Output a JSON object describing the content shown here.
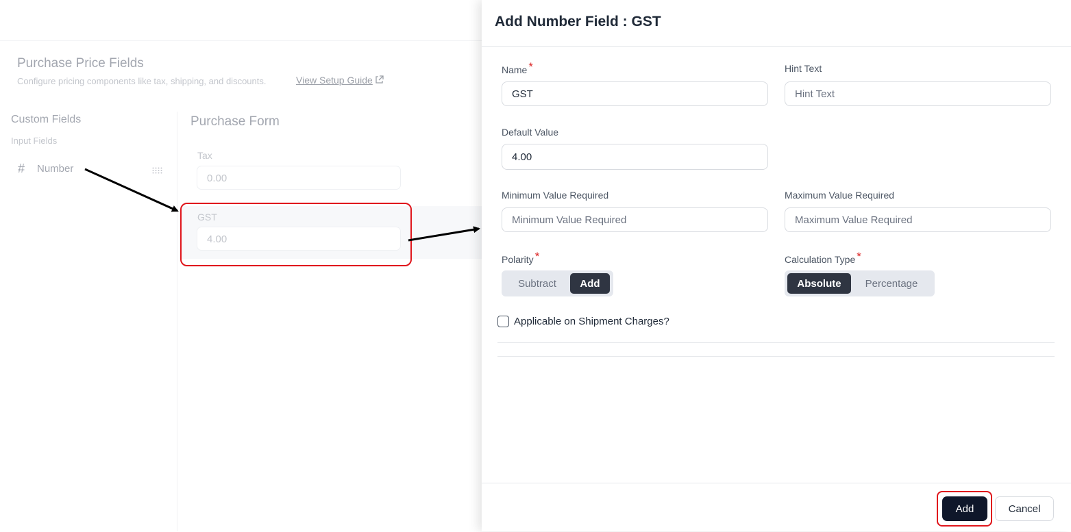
{
  "background": {
    "title": "Purchase Price Fields",
    "subtitle": "Configure pricing components like tax, shipping, and discounts.",
    "setup_guide_link": "View Setup Guide",
    "left_panel": {
      "title": "Custom Fields",
      "subtitle": "Input Fields",
      "item_icon": "#",
      "item_label": "Number"
    },
    "form": {
      "title": "Purchase Form",
      "fields": [
        {
          "label": "Tax",
          "value": "0.00"
        },
        {
          "label": "GST",
          "value": "4.00"
        }
      ]
    }
  },
  "drawer": {
    "title": "Add Number Field : GST",
    "name": {
      "label": "Name",
      "required_mark": "*",
      "value": "GST"
    },
    "hint": {
      "label": "Hint Text",
      "placeholder": "Hint Text"
    },
    "default_value": {
      "label": "Default Value",
      "value": "4.00"
    },
    "min_value": {
      "label": "Minimum Value Required",
      "placeholder": "Minimum Value Required"
    },
    "max_value": {
      "label": "Maximum Value Required",
      "placeholder": "Maximum Value Required"
    },
    "polarity": {
      "label": "Polarity",
      "required_mark": "*",
      "options": [
        "Subtract",
        "Add"
      ],
      "selected": "Add"
    },
    "calculation_type": {
      "label": "Calculation Type",
      "required_mark": "*",
      "options": [
        "Absolute",
        "Percentage"
      ],
      "selected": "Absolute"
    },
    "shipment_checkbox": {
      "label": "Applicable on Shipment Charges?",
      "checked": false
    },
    "footer": {
      "add_label": "Add",
      "cancel_label": "Cancel"
    }
  },
  "colors": {
    "highlight_red": "#e0161c",
    "primary_dark": "#0f172a",
    "segment_active": "#2f3542"
  }
}
